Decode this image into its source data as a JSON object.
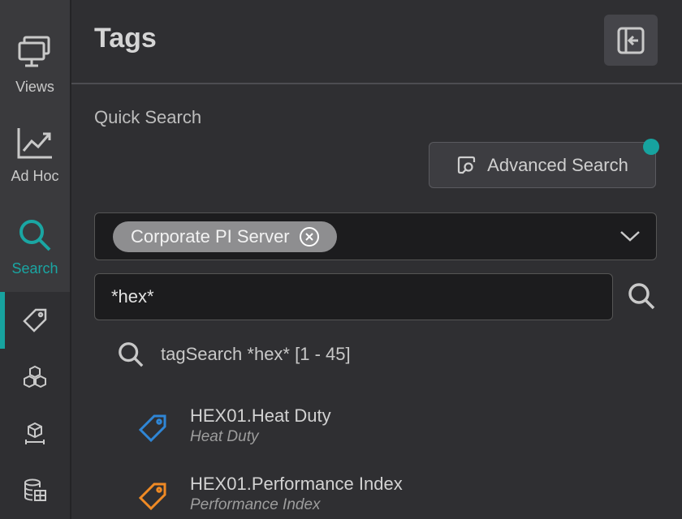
{
  "rail": {
    "items": [
      {
        "label": "Views",
        "icon": "monitor-icon"
      },
      {
        "label": "Ad Hoc",
        "icon": "trend-chart-icon"
      },
      {
        "label": "Search",
        "icon": "search-icon"
      }
    ],
    "sub_items": [
      "tag-icon",
      "cubes-icon",
      "cube-on-stand-icon",
      "database-grid-icon"
    ],
    "accent_color": "#1aa6a3"
  },
  "header": {
    "title": "Tags"
  },
  "quick_search": {
    "label": "Quick Search",
    "advanced_button": "Advanced Search",
    "server_chip": "Corporate PI Server",
    "query_value": "*hex*",
    "query_placeholder": ""
  },
  "results": {
    "summary": "tagSearch *hex* [1 - 45]",
    "items": [
      {
        "name": "HEX01.Heat Duty",
        "description": "Heat Duty",
        "icon_color": "#2f86d6"
      },
      {
        "name": "HEX01.Performance Index",
        "description": "Performance Index",
        "icon_color": "#f08a24"
      }
    ]
  }
}
